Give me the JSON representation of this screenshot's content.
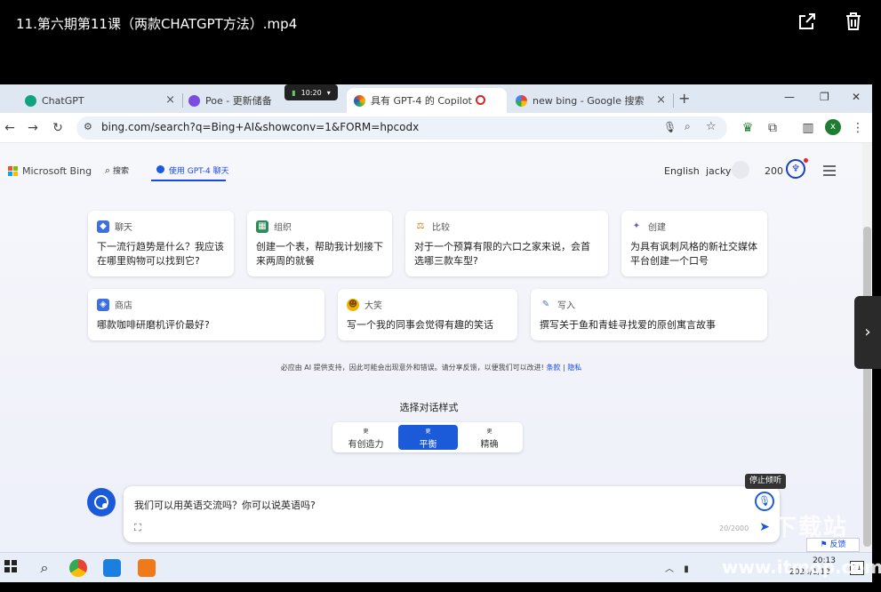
{
  "video": {
    "title": "11.第六期第11课（两款CHATGPT方法）.mp4",
    "share_icon": "share-icon",
    "delete_icon": "trash-icon",
    "next_icon": "chevron-right-icon"
  },
  "browser": {
    "timer": "10:20",
    "tabs": [
      {
        "label": "ChatGPT",
        "close": "×",
        "fav_color": "#10a37f"
      },
      {
        "label": "Poe - 更新储备",
        "close": "×",
        "fav_color": "#7b4ce0"
      },
      {
        "label": "具有 GPT-4 的 Copilot",
        "close": "",
        "fav_color": "#e8561d"
      },
      {
        "label": "new bing - Google 搜索",
        "close": "×",
        "fav_color": "#4285f4"
      }
    ],
    "new_tab": "+",
    "win_min": "—",
    "win_max": "❐",
    "win_close": "✕",
    "url": "bing.com/search?q=Bing+AI&showconv=1&FORM=hpcodx",
    "profile_letter": "x"
  },
  "bing": {
    "logo_text": "Microsoft Bing",
    "nav_search": "搜索",
    "nav_chat": "使用 GPT-4 聊天",
    "lang": "English",
    "user": "jacky",
    "points": "200",
    "cards_row1": [
      {
        "tag": "聊天",
        "text": "下一流行趋势是什么？我应该在哪里购物可以找到它?",
        "icon_color": "#3d6fe0"
      },
      {
        "tag": "组织",
        "text": "创建一个表，帮助我计划接下来两周的就餐",
        "icon_color": "#2e8b57"
      },
      {
        "tag": "比较",
        "text": "对于一个预算有限的六口之家来说，会首选哪三款车型?",
        "icon_color": "#b8860b"
      },
      {
        "tag": "创建",
        "text": "为具有讽刺风格的新社交媒体平台创建一个口号",
        "icon_color": "#6a5acd"
      }
    ],
    "cards_row2": [
      {
        "tag": "商店",
        "text": "哪款咖啡研磨机评价最好?",
        "icon_color": "#3d6fe0"
      },
      {
        "tag": "大笑",
        "text": "写一个我的同事会觉得有趣的笑话",
        "icon_color": "#f0b400"
      },
      {
        "tag": "写入",
        "text": "撰写关于鱼和青蛙寻找爱的原创寓言故事",
        "icon_color": "#4a6fd0"
      }
    ],
    "disclaimer": "必应由 AI 提供支持，因此可能会出现意外和错误。请分享反馈，以便我们可以改进!",
    "terms": "条款",
    "privacy": "隐私",
    "style_title": "选择对话样式",
    "styles": [
      {
        "sup": "更",
        "label": "有创造力"
      },
      {
        "sup": "更",
        "label": "平衡"
      },
      {
        "sup": "更",
        "label": "精确"
      }
    ],
    "input_text": "我们可以用英语交流吗？你可以说英语吗?",
    "char_count": "20/2000",
    "tooltip": "停止倾听",
    "feedback": "反馈"
  },
  "taskbar": {
    "time": "20:13",
    "date": "2024/1/13",
    "badge": "21"
  },
  "watermark": {
    "big": "下载站",
    "url": "www.itmop.com"
  }
}
